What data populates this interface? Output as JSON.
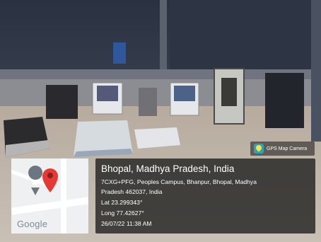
{
  "badge": {
    "label": "GPS Map Camera",
    "icon": "gps-map-camera-app-icon"
  },
  "map": {
    "logo_text": "Google",
    "pin_color": "#e53935"
  },
  "location": {
    "title": "Bhopal, Madhya Pradesh, India",
    "address_line1": "7CXG+PFG, Peoples Campus, Bhanpur, Bhopal, Madhya",
    "address_line2": "Pradesh 462037, India",
    "latitude": "Lat 23.299343°",
    "longitude": "Long 77.42627°",
    "datetime": "26/07/22 11:38 AM"
  }
}
